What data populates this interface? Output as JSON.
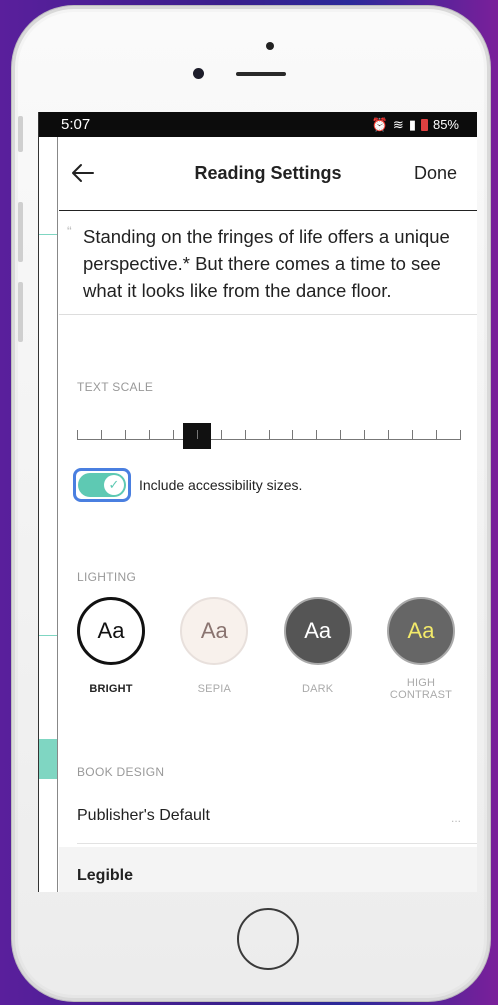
{
  "status_bar": {
    "time": "5:07",
    "battery": "85%"
  },
  "header": {
    "title": "Reading Settings",
    "done_label": "Done"
  },
  "preview": {
    "quote_mark": "“",
    "text": "Standing on the fringes of life offers a unique perspective.* But there comes a time to see what it looks like from the dance floor."
  },
  "text_scale": {
    "label": "TEXT SCALE",
    "value_index": 5,
    "steps": 16
  },
  "accessibility": {
    "label": "Include accessibility sizes.",
    "checked": true
  },
  "lighting": {
    "label": "LIGHTING",
    "options": [
      {
        "sample": "Aa",
        "name": "BRIGHT",
        "selected": true
      },
      {
        "sample": "Aa",
        "name": "SEPIA",
        "selected": false
      },
      {
        "sample": "Aa",
        "name": "DARK",
        "selected": false
      },
      {
        "sample": "Aa",
        "name": "HIGH\nCONTRAST",
        "selected": false
      }
    ]
  },
  "book_design": {
    "label": "BOOK DESIGN",
    "options": [
      {
        "name": "Publisher's Default",
        "menu": "..."
      },
      {
        "name": "Legible"
      }
    ]
  },
  "colors": {
    "accent_teal": "#5ec9b3",
    "focus_blue": "#4a7fe0",
    "sepia_bg": "#f8f1ec",
    "hc_text": "#f3ea6a"
  }
}
